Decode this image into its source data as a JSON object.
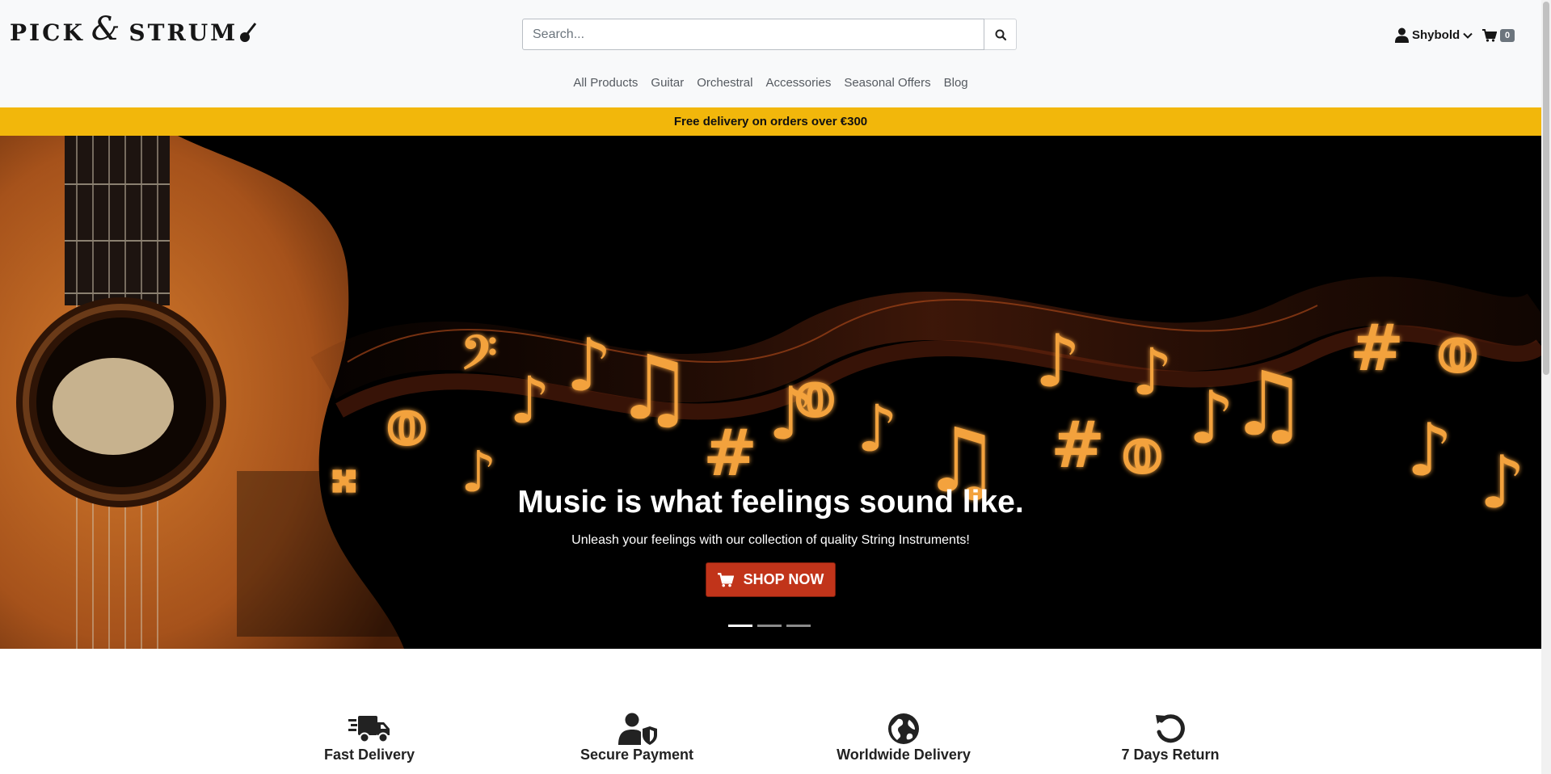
{
  "brand": {
    "word1": "PICK",
    "amp": "&",
    "word2": "STRUM"
  },
  "search": {
    "placeholder": "Search...",
    "icon": "search-icon"
  },
  "user": {
    "name": "Shybold",
    "icon": "user-icon"
  },
  "cart": {
    "count": "0",
    "icon": "cart-icon"
  },
  "nav": {
    "items": [
      "All Products",
      "Guitar",
      "Orchestral",
      "Accessories",
      "Seasonal Offers",
      "Blog"
    ]
  },
  "promo": {
    "text": "Free delivery on orders over €300",
    "color": "#f2b70b"
  },
  "hero": {
    "title": "Music is what feelings sound like.",
    "subtitle": "Unleash your feelings with our collection of quality String Instruments!",
    "button": "SHOP NOW",
    "button_color": "#c1341a",
    "slides": 3,
    "active_slide": 1
  },
  "features": [
    {
      "label": "Fast Delivery",
      "icon": "truck-icon"
    },
    {
      "label": "Secure Payment",
      "icon": "user-shield-icon"
    },
    {
      "label": "Worldwide Delivery",
      "icon": "globe-icon"
    },
    {
      "label": "7 Days Return",
      "icon": "undo-icon"
    }
  ]
}
